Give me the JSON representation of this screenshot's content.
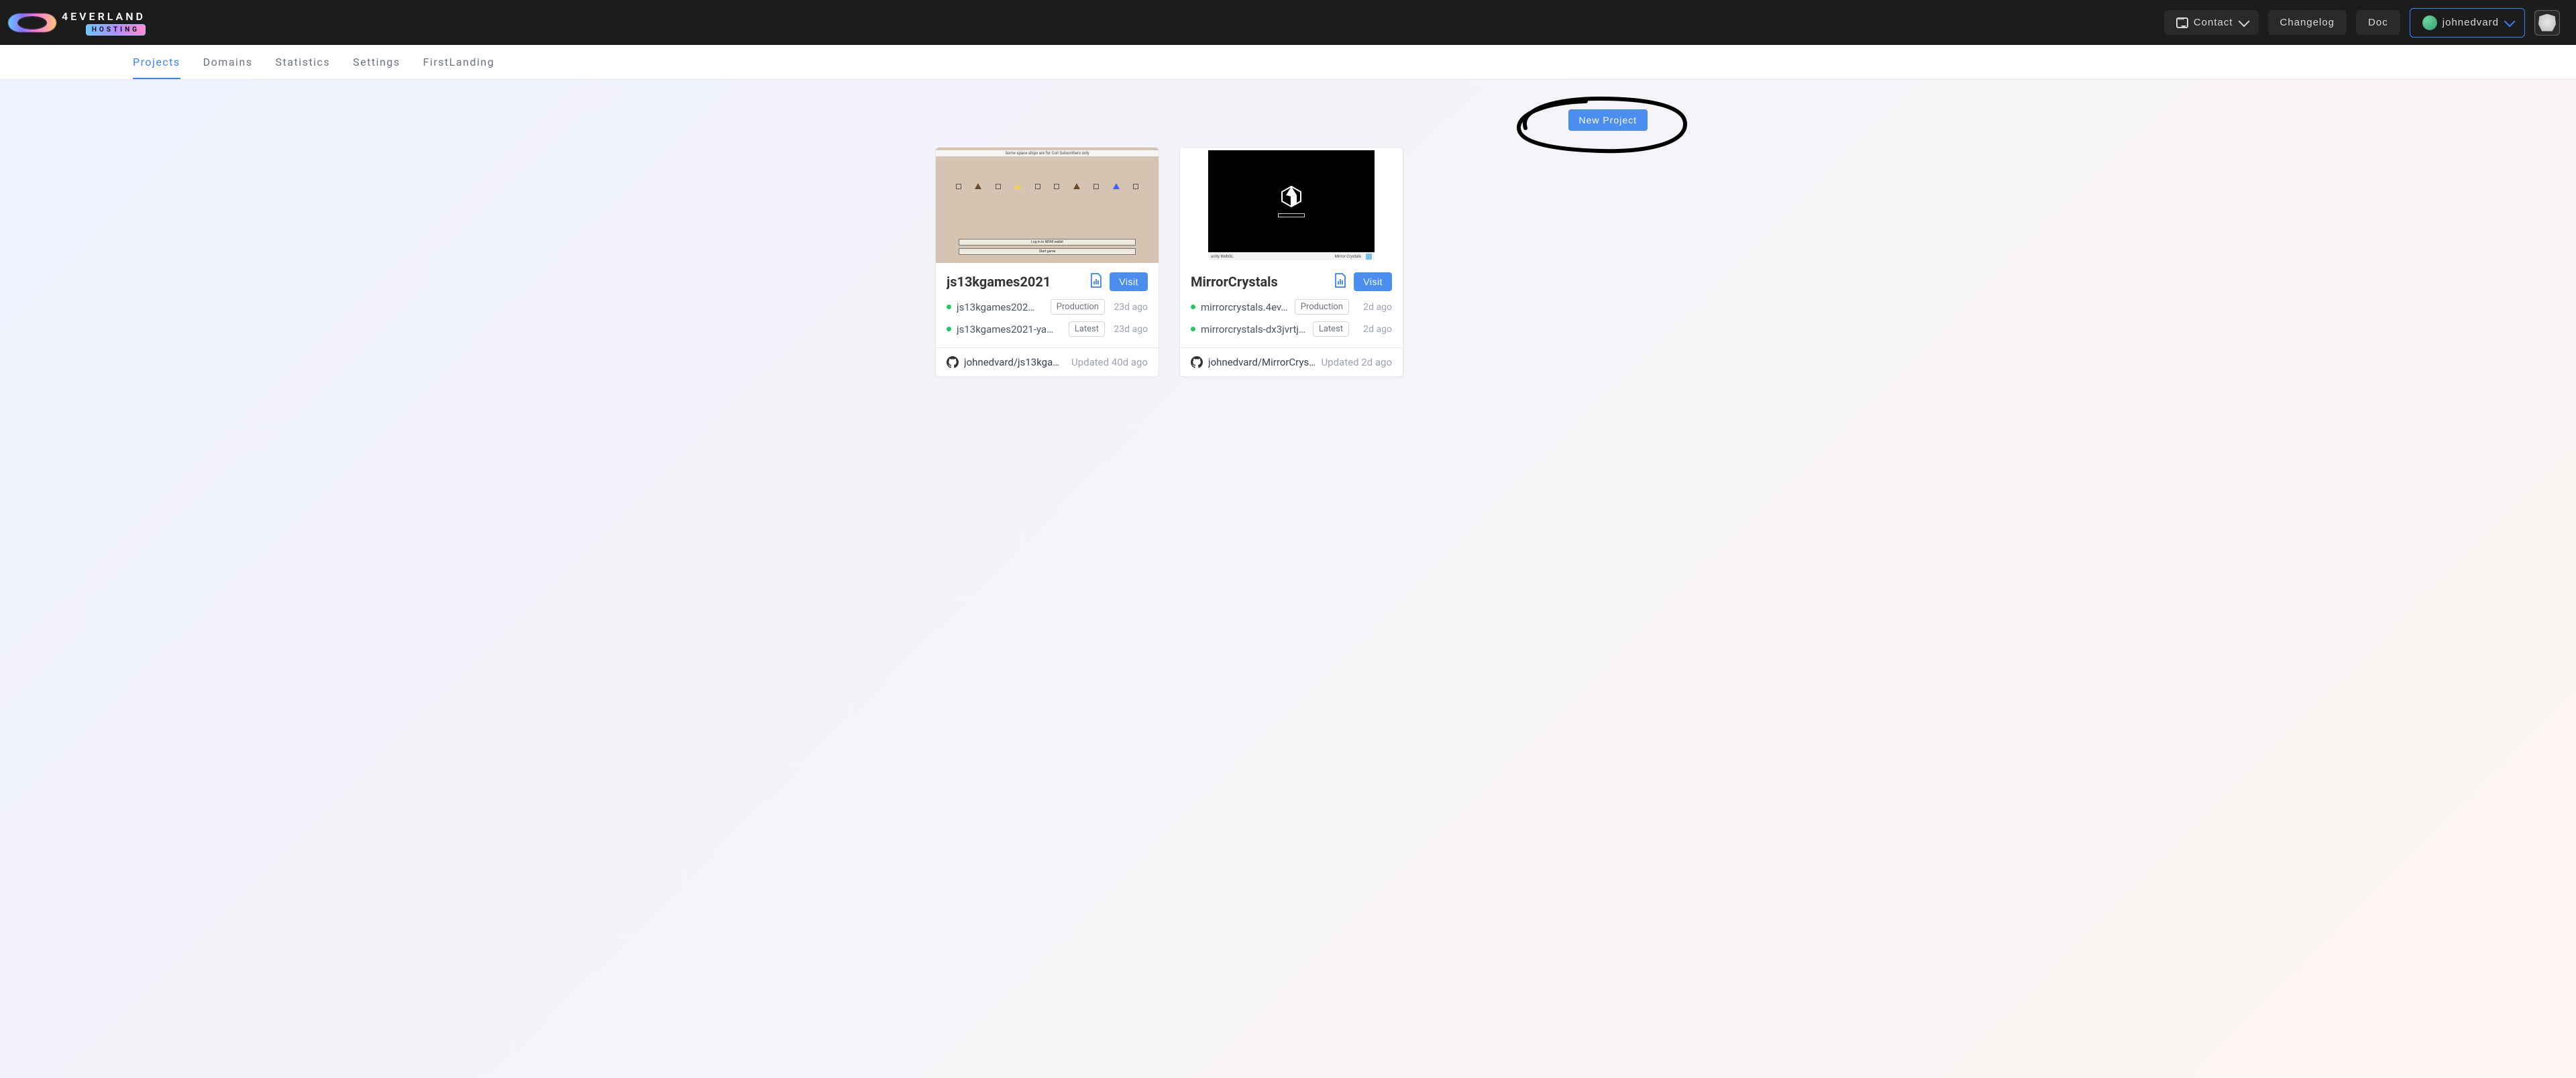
{
  "header": {
    "brand_name": "4EVERLAND",
    "brand_sub": "HOSTING",
    "contact_label": "Contact",
    "changelog_label": "Changelog",
    "doc_label": "Doc",
    "user_handle": "johnedvard"
  },
  "nav": {
    "tabs": [
      {
        "label": "Projects",
        "active": true
      },
      {
        "label": "Domains",
        "active": false
      },
      {
        "label": "Statistics",
        "active": false
      },
      {
        "label": "Settings",
        "active": false
      },
      {
        "label": "FirstLanding",
        "active": false
      }
    ]
  },
  "actions": {
    "new_project_label": "New Project"
  },
  "thumb1": {
    "top_text": "Some space ships are for Coil Subscribers only",
    "btn1": "Log in to NEAR wallet",
    "btn2": "Start game"
  },
  "thumb2": {
    "engine": "unity WebGL",
    "title_small": "Mirror Crystals"
  },
  "cards": [
    {
      "title": "js13kgames2021",
      "visit_label": "Visit",
      "deployments": [
        {
          "url": "js13kgames202…",
          "tag": "Production",
          "age": "23d ago"
        },
        {
          "url": "js13kgames2021-ya…",
          "tag": "Latest",
          "age": "23d ago"
        }
      ],
      "repo": "johnedvard/js13kga…",
      "updated": "Updated 40d ago"
    },
    {
      "title": "MirrorCrystals",
      "visit_label": "Visit",
      "deployments": [
        {
          "url": "mirrorcrystals.4ev…",
          "tag": "Production",
          "age": "2d ago"
        },
        {
          "url": "mirrorcrystals-dx3jvrtj…",
          "tag": "Latest",
          "age": "2d ago"
        }
      ],
      "repo": "johnedvard/MirrorCrys…",
      "updated": "Updated 2d ago"
    }
  ]
}
